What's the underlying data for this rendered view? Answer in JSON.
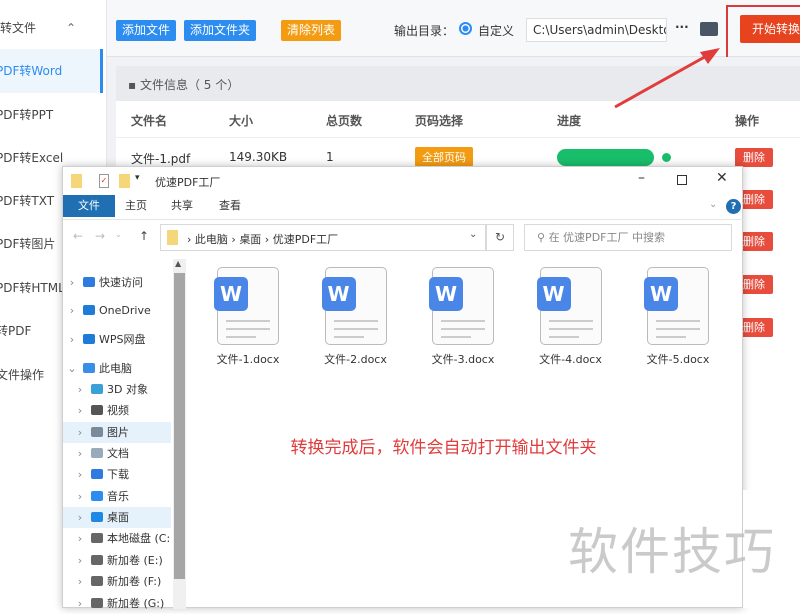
{
  "sidebar": {
    "header": "转文件",
    "items": [
      "PDF转Word",
      "PDF转PPT",
      "PDF转Excel",
      "PDF转TXT",
      "PDF转图片",
      "PDF转HTML",
      "转PDF",
      "文件操作"
    ]
  },
  "toolbar": {
    "add_file": "添加文件",
    "add_folder": "添加文件夹",
    "clear_list": "清除列表",
    "output_label": "输出目录：",
    "radio_label": "自定义",
    "output_path": "C:\\Users\\admin\\Deskto",
    "more": "···",
    "start": "开始转换"
  },
  "file_info": {
    "title": "文件信息（ 5 个）",
    "headers": [
      "文件名",
      "大小",
      "总页数",
      "页码选择",
      "进度",
      "操作"
    ],
    "row": {
      "name": "文件-1.pdf",
      "size": "149.30KB",
      "pages": "1",
      "page_select": "全部页码",
      "progress": 1.0
    },
    "delete_label": "删除"
  },
  "explorer": {
    "title": "优速PDF工厂",
    "tabs": [
      "文件",
      "主页",
      "共享",
      "查看"
    ],
    "path": [
      "此电脑",
      "桌面",
      "优速PDF工厂"
    ],
    "search_placeholder": "在 优速PDF工厂 中搜索",
    "nav": [
      {
        "label": "快速访问",
        "icon": "star-icon"
      },
      {
        "label": "OneDrive",
        "icon": "cloud-icon"
      },
      {
        "label": "WPS网盘",
        "icon": "cloud-icon"
      },
      {
        "label": "此电脑",
        "icon": "pc-icon"
      },
      {
        "label": "3D 对象",
        "icon": "cube-icon"
      },
      {
        "label": "视频",
        "icon": "video-icon"
      },
      {
        "label": "图片",
        "icon": "picture-icon"
      },
      {
        "label": "文档",
        "icon": "document-icon"
      },
      {
        "label": "下载",
        "icon": "download-icon"
      },
      {
        "label": "音乐",
        "icon": "music-icon"
      },
      {
        "label": "桌面",
        "icon": "desktop-icon"
      },
      {
        "label": "本地磁盘 (C:)",
        "icon": "drive-icon"
      },
      {
        "label": "新加卷 (E:)",
        "icon": "drive-icon"
      },
      {
        "label": "新加卷 (F:)",
        "icon": "drive-icon"
      },
      {
        "label": "新加卷 (G:)",
        "icon": "drive-icon"
      }
    ],
    "files": [
      "文件-1.docx",
      "文件-2.docx",
      "文件-3.docx",
      "文件-4.docx",
      "文件-5.docx"
    ]
  },
  "annotation": "转换完成后，软件会自动打开输出文件夹",
  "watermark": "软件技巧",
  "colors": {
    "blue": "#2d8cf0",
    "orange": "#f39c12",
    "red": "#e8431f",
    "green": "#19be6b"
  }
}
